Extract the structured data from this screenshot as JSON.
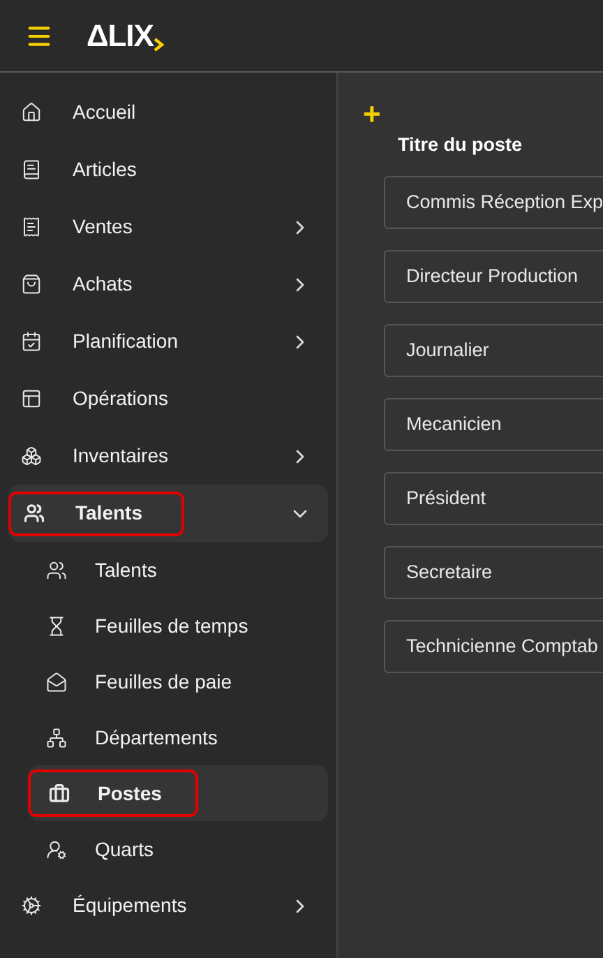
{
  "header": {
    "logo": "ΔLIX"
  },
  "sidebar": {
    "items": [
      {
        "label": "Accueil",
        "kind": "link",
        "highlighted": false
      },
      {
        "label": "Articles",
        "kind": "link",
        "highlighted": false
      },
      {
        "label": "Ventes",
        "kind": "menu",
        "expanded": false,
        "highlighted": false
      },
      {
        "label": "Achats",
        "kind": "menu",
        "expanded": false,
        "highlighted": false
      },
      {
        "label": "Planification",
        "kind": "menu",
        "expanded": false,
        "highlighted": false
      },
      {
        "label": "Opérations",
        "kind": "link",
        "highlighted": false
      },
      {
        "label": "Inventaires",
        "kind": "menu",
        "expanded": false,
        "highlighted": false
      },
      {
        "label": "Talents",
        "kind": "menu",
        "expanded": true,
        "highlighted": true,
        "children": [
          {
            "label": "Talents",
            "selected": false,
            "highlighted": false
          },
          {
            "label": "Feuilles de temps",
            "selected": false,
            "highlighted": false
          },
          {
            "label": "Feuilles de paie",
            "selected": false,
            "highlighted": false
          },
          {
            "label": "Départements",
            "selected": false,
            "highlighted": false
          },
          {
            "label": "Postes",
            "selected": true,
            "highlighted": true
          },
          {
            "label": "Quarts",
            "selected": false,
            "highlighted": false
          }
        ]
      },
      {
        "label": "Équipements",
        "kind": "menu",
        "expanded": false,
        "highlighted": false
      }
    ]
  },
  "main": {
    "add_button": "+",
    "column_title": "Titre du poste",
    "rows": [
      "Commis Réception Exp",
      "Directeur Production",
      "Journalier",
      "Mecanicien",
      "Président",
      "Secretaire",
      "Technicienne Comptab"
    ]
  }
}
